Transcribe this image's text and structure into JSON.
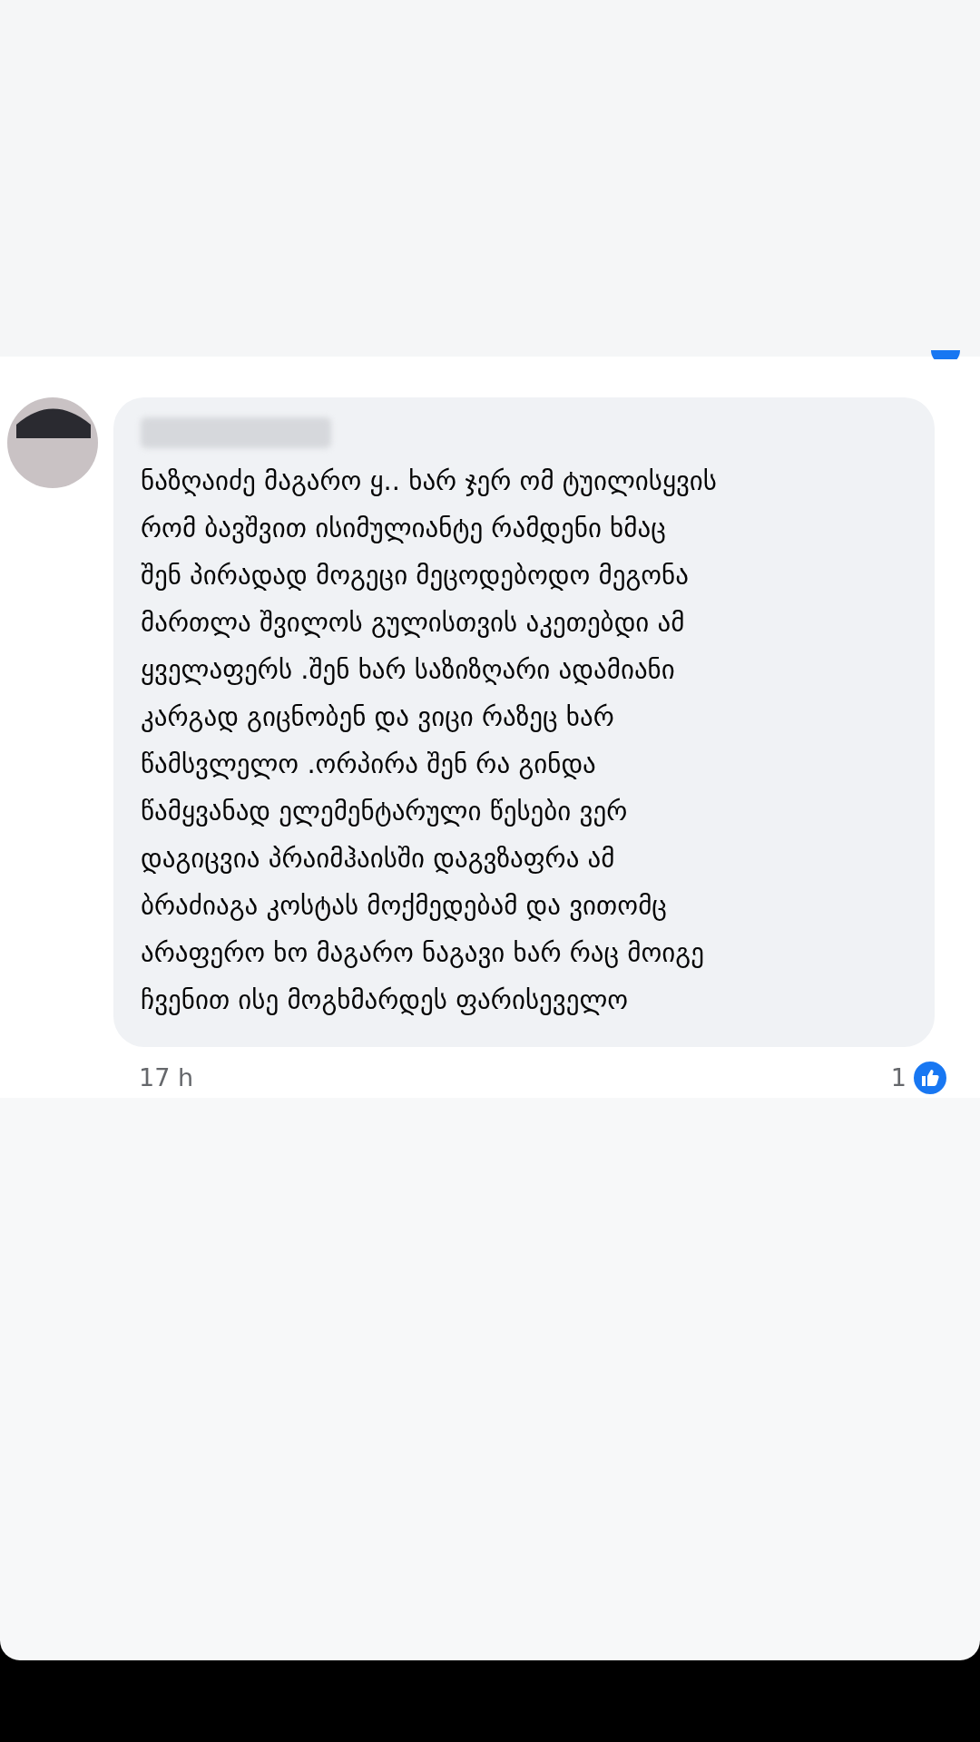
{
  "comment": {
    "text": "ნაზღაიძე მაგარო ყ.. ხარ ჯერ ომ ტუილისყვის\nრომ ბავშვით ისიმულიანტე რამდენი ხმაც\nშენ პირადად მოგეცი მეცოდებოდო მეგონა\nმართლა შვილოს გულისთვის აკეთებდი ამ\nყველაფერს .შენ ხარ საზიზღარი ადამიანი\nკარგად გიცნობენ და ვიცი რაზეც ხარ\nწამსვლელო .ორპირა შენ რა გინდა\nწამყვანად ელემენტარული წესები ვერ\nდაგიცვია პრაიმჰაისში დაგვზაფრა ამ\nბრაძიაგა კოსტას მოქმედებამ და  ვითომც\nარაფერო ხო მაგარო ნაგავი ხარ რაც მოიგე\nჩვენით ისე მოგხმარდეს ფარისეველო",
    "time": "17 h",
    "reaction_count": "1"
  }
}
